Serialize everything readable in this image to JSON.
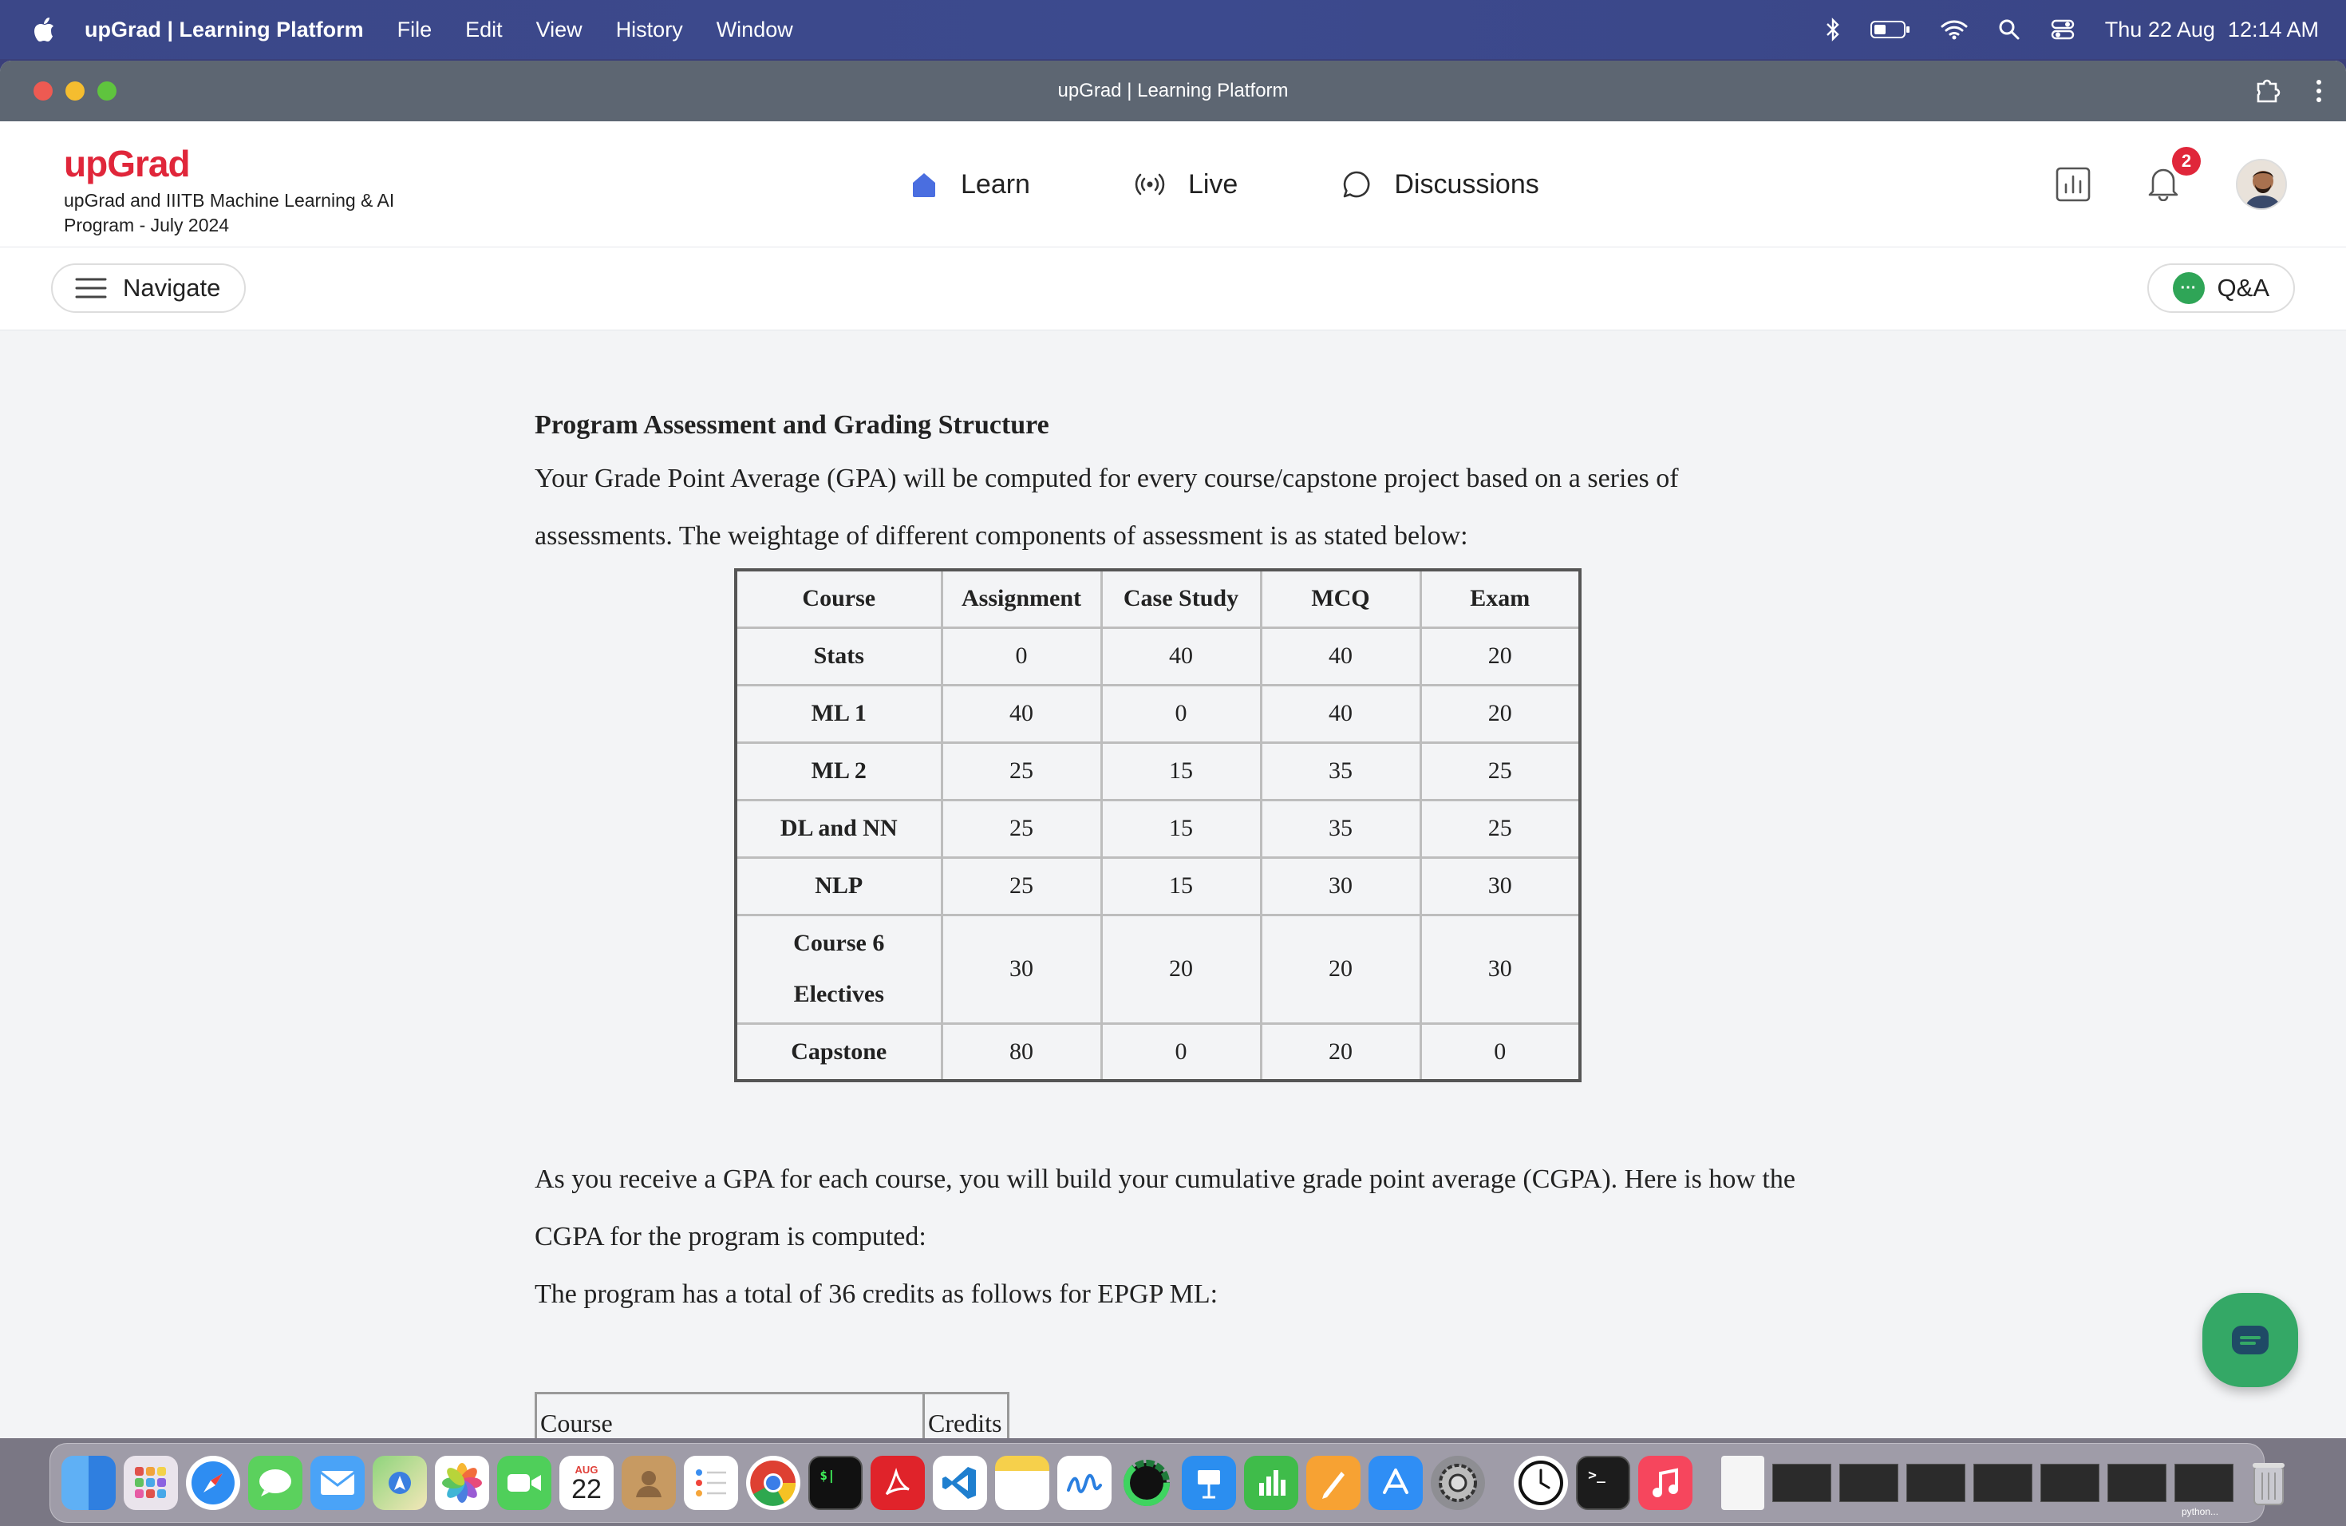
{
  "menubar": {
    "app_name": "upGrad | Learning Platform",
    "menus": [
      "File",
      "Edit",
      "View",
      "History",
      "Window"
    ],
    "date": "Thu 22 Aug",
    "time": "12:14 AM"
  },
  "window": {
    "title": "upGrad | Learning Platform"
  },
  "header": {
    "logo": "upGrad",
    "program_line1": "upGrad and IIITB Machine Learning & AI",
    "program_line2": "Program - July 2024",
    "nav": {
      "learn": "Learn",
      "live": "Live",
      "discussions": "Discussions"
    },
    "notification_count": "2"
  },
  "subbar": {
    "navigate": "Navigate",
    "qa": "Q&A"
  },
  "content": {
    "heading": "Program Assessment and Grading Structure",
    "intro": "Your Grade Point Average (GPA) will be computed for every course/capstone project based on a series of assessments. The weightage of different components of assessment is as stated below:",
    "grading_table": {
      "headers": [
        "Course",
        "Assignment",
        "Case Study",
        "MCQ",
        "Exam"
      ],
      "rows": [
        [
          "Stats",
          "0",
          "40",
          "40",
          "20"
        ],
        [
          "ML 1",
          "40",
          "0",
          "40",
          "20"
        ],
        [
          "ML 2",
          "25",
          "15",
          "35",
          "25"
        ],
        [
          "DL and NN",
          "25",
          "15",
          "35",
          "25"
        ],
        [
          "NLP",
          "25",
          "15",
          "30",
          "30"
        ],
        [
          "Course 6 Electives",
          "30",
          "20",
          "20",
          "30"
        ],
        [
          "Capstone",
          "80",
          "0",
          "20",
          "0"
        ]
      ]
    },
    "cgpa_text": "As you receive a GPA for each course, you will build your cumulative grade point average (CGPA). Here is how the CGPA for the program is computed:",
    "credits_text": "The program has a total of 36 credits as follows for EPGP ML:",
    "credits_table": {
      "headers": [
        "Course",
        "Credits"
      ]
    }
  },
  "dock": {
    "calendar_month": "AUG",
    "calendar_day": "22",
    "last_thumb_label": "python..."
  }
}
